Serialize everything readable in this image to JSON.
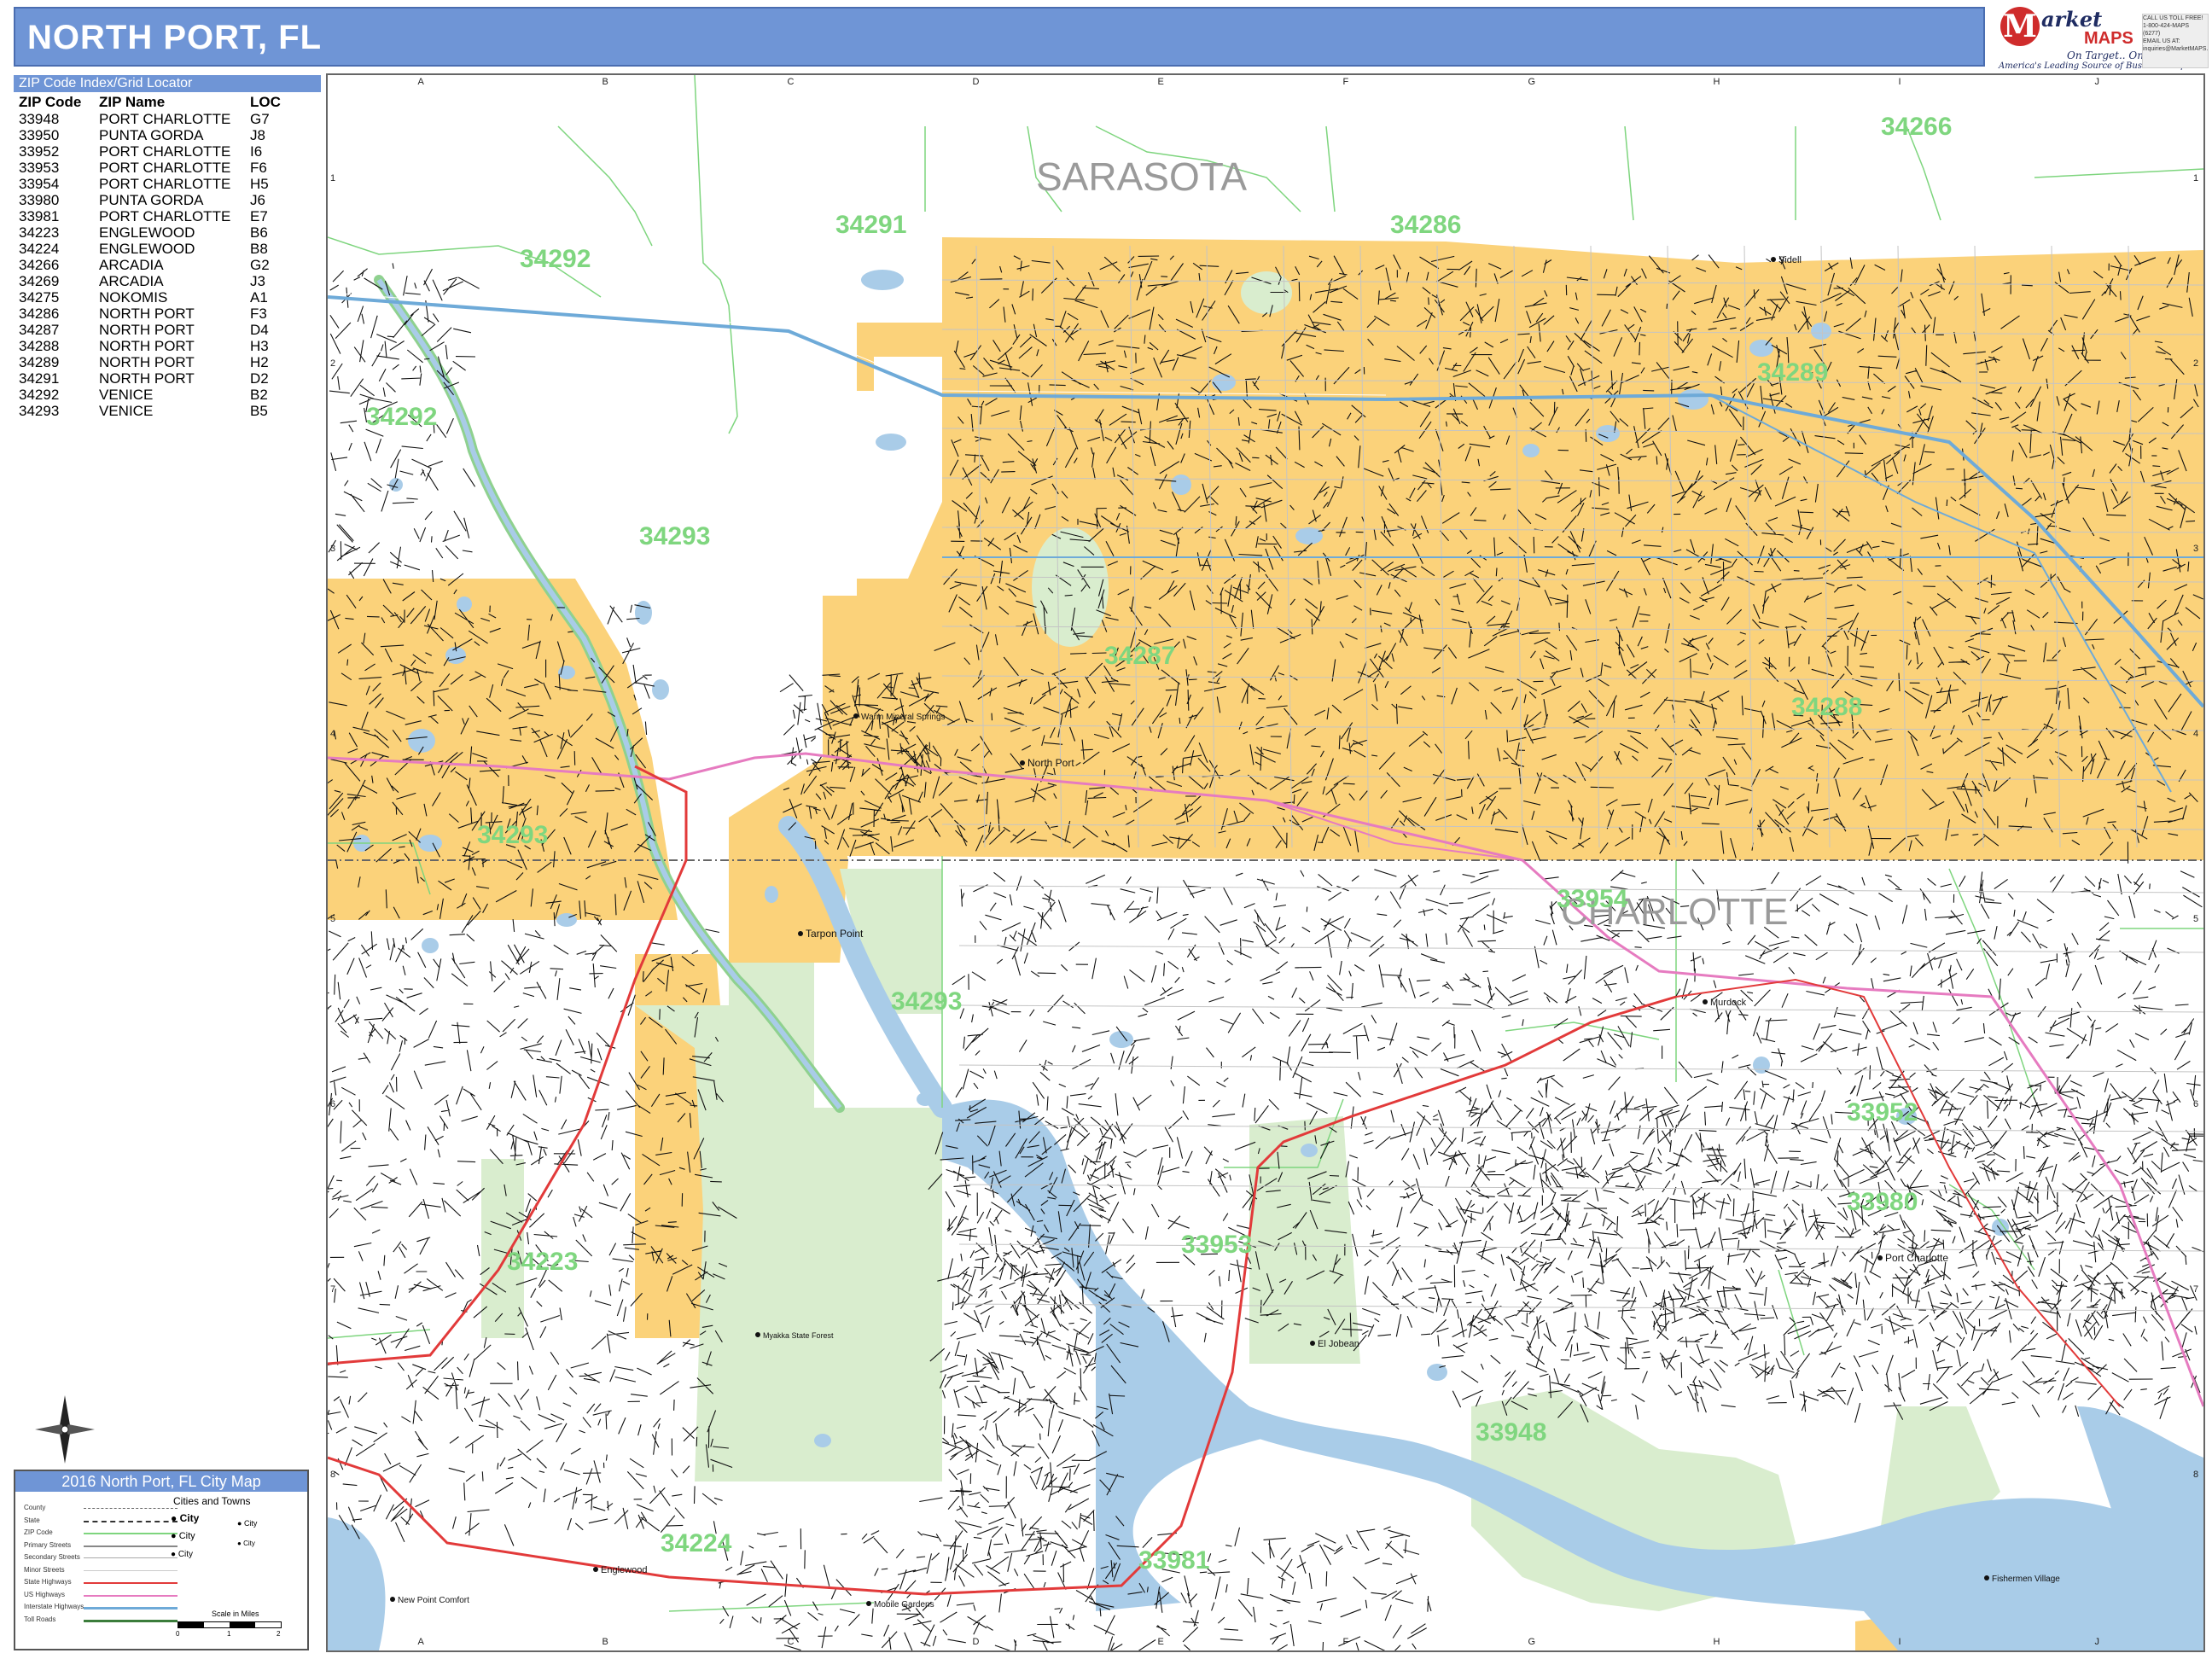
{
  "title": "NORTH PORT, FL",
  "logo": {
    "mark": "M",
    "word1": "arket",
    "word2": "MAPS",
    "tagline": "On Target.. On Time.",
    "subline": "America's Leading Source of Business Maps"
  },
  "contact": {
    "lines": [
      "CALL US TOLL FREE!",
      "1-800-424-MAPS (6277)",
      "EMAIL US AT:",
      "inquiries@MarketMAPS.com"
    ]
  },
  "zip_index": {
    "header": "ZIP Code Index/Grid Locator",
    "columns": [
      "ZIP Code",
      "ZIP Name",
      "LOC"
    ],
    "rows": [
      [
        "33948",
        "PORT CHARLOTTE",
        "G7"
      ],
      [
        "33950",
        "PUNTA GORDA",
        "J8"
      ],
      [
        "33952",
        "PORT CHARLOTTE",
        "I6"
      ],
      [
        "33953",
        "PORT CHARLOTTE",
        "F6"
      ],
      [
        "33954",
        "PORT CHARLOTTE",
        "H5"
      ],
      [
        "33980",
        "PUNTA GORDA",
        "J6"
      ],
      [
        "33981",
        "PORT CHARLOTTE",
        "E7"
      ],
      [
        "34223",
        "ENGLEWOOD",
        "B6"
      ],
      [
        "34224",
        "ENGLEWOOD",
        "B8"
      ],
      [
        "34266",
        "ARCADIA",
        "G2"
      ],
      [
        "34269",
        "ARCADIA",
        "J3"
      ],
      [
        "34275",
        "NOKOMIS",
        "A1"
      ],
      [
        "34286",
        "NORTH PORT",
        "F3"
      ],
      [
        "34287",
        "NORTH PORT",
        "D4"
      ],
      [
        "34288",
        "NORTH PORT",
        "H3"
      ],
      [
        "34289",
        "NORTH PORT",
        "H2"
      ],
      [
        "34291",
        "NORTH PORT",
        "D2"
      ],
      [
        "34292",
        "VENICE",
        "B2"
      ],
      [
        "34293",
        "VENICE",
        "B5"
      ]
    ]
  },
  "legend": {
    "title": "2016 North Port, FL City Map",
    "items": [
      "County",
      "State",
      "ZIP Code",
      "Primary Streets",
      "Secondary Streets",
      "Minor Streets",
      "State Highways",
      "US Highways",
      "Interstate Highways",
      "Toll Roads"
    ],
    "cities_heading": "Cities and Towns",
    "city_labels": [
      "City",
      "City",
      "City",
      "City",
      "City"
    ],
    "scale_title": "Scale in Miles",
    "scale_ticks": [
      "0",
      "1",
      "2"
    ]
  },
  "map": {
    "grid_letters": [
      "A",
      "B",
      "C",
      "D",
      "E",
      "F",
      "G",
      "H",
      "I",
      "J"
    ],
    "grid_numbers": [
      "1",
      "2",
      "3",
      "4",
      "5",
      "6",
      "7",
      "8"
    ],
    "county_labels": [
      "SARASOTA",
      "CHARLOTTE"
    ],
    "zip_labels": [
      "34266",
      "34286",
      "34291",
      "34292",
      "34289",
      "34292",
      "34293",
      "34287",
      "34288",
      "34293",
      "33954",
      "34293",
      "33952",
      "33953",
      "34223",
      "33980",
      "33948",
      "34224",
      "33981"
    ],
    "place_labels": [
      "Tarpon Point",
      "North Port",
      "Warm Mineral Springs",
      "Murdock",
      "Port Charlotte",
      "El Jobean",
      "Englewood",
      "Mobile Gardens",
      "New Point Comfort",
      "Sidell",
      "Fishermen Village",
      "Myakka State Forest"
    ],
    "colors": {
      "zip_highlight": "#fbd27a",
      "water": "#a9cce8",
      "park": "#d9edce",
      "zip_line": "#7ed57e",
      "state_highway": "#e23a3a",
      "us_highway": "#e67bc0",
      "interstate": "#6eaad8",
      "zip_text": "#7fd67f",
      "county_text": "#9a9a9a"
    }
  }
}
